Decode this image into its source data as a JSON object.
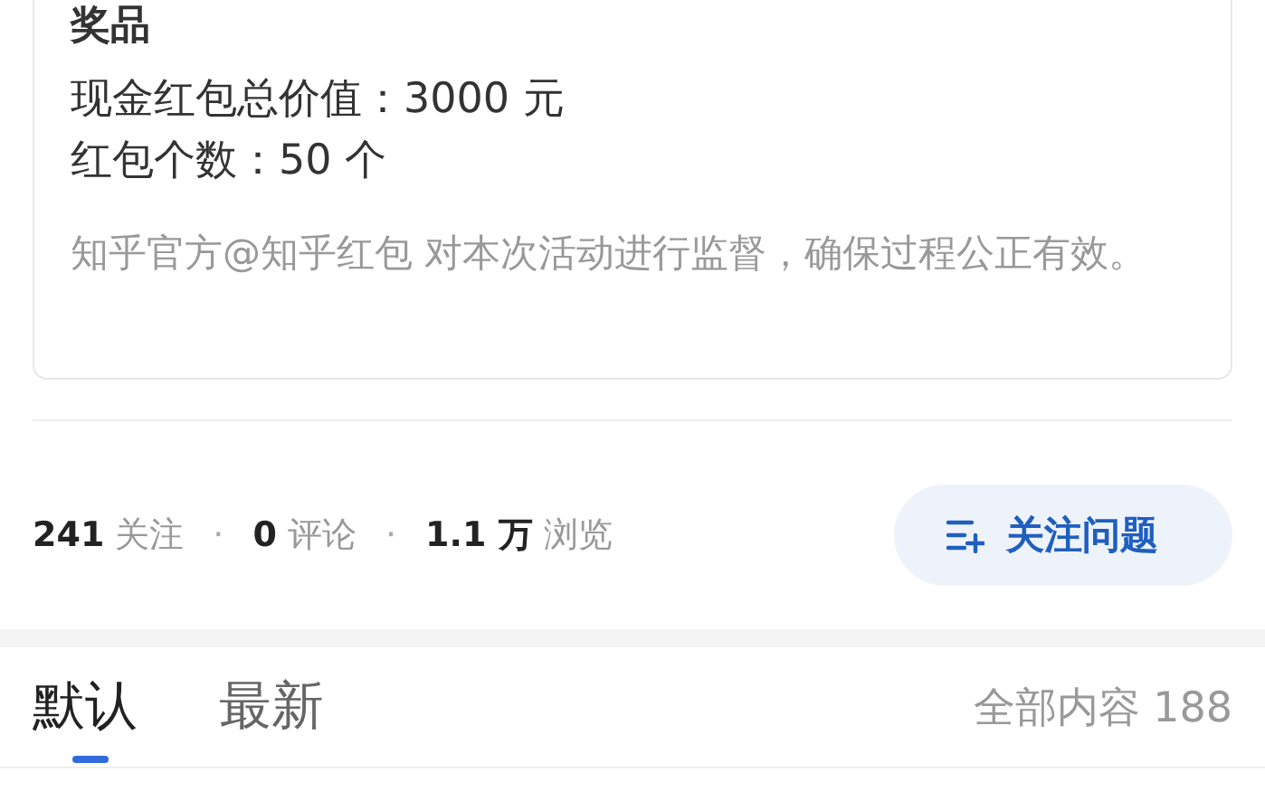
{
  "prize_card": {
    "title": "奖品",
    "lines": [
      "现金红包总价值：3000 元",
      "红包个数：50 个"
    ],
    "note": "知乎官方@知乎红包 对本次活动进行监督，确保过程公正有效。"
  },
  "stats": [
    {
      "kind": "stat",
      "count": "241",
      "label": "关注"
    },
    {
      "kind": "separator",
      "text": "·"
    },
    {
      "kind": "stat",
      "count": "0",
      "label": "评论"
    },
    {
      "kind": "separator",
      "text": "·"
    },
    {
      "kind": "stat",
      "count": "1.1 万",
      "label": "浏览"
    }
  ],
  "follow_button": {
    "label": "关注问题"
  },
  "tabs": [
    {
      "label": "默认",
      "selected": true
    },
    {
      "label": "最新",
      "selected": false
    }
  ],
  "total": "全部内容 188"
}
